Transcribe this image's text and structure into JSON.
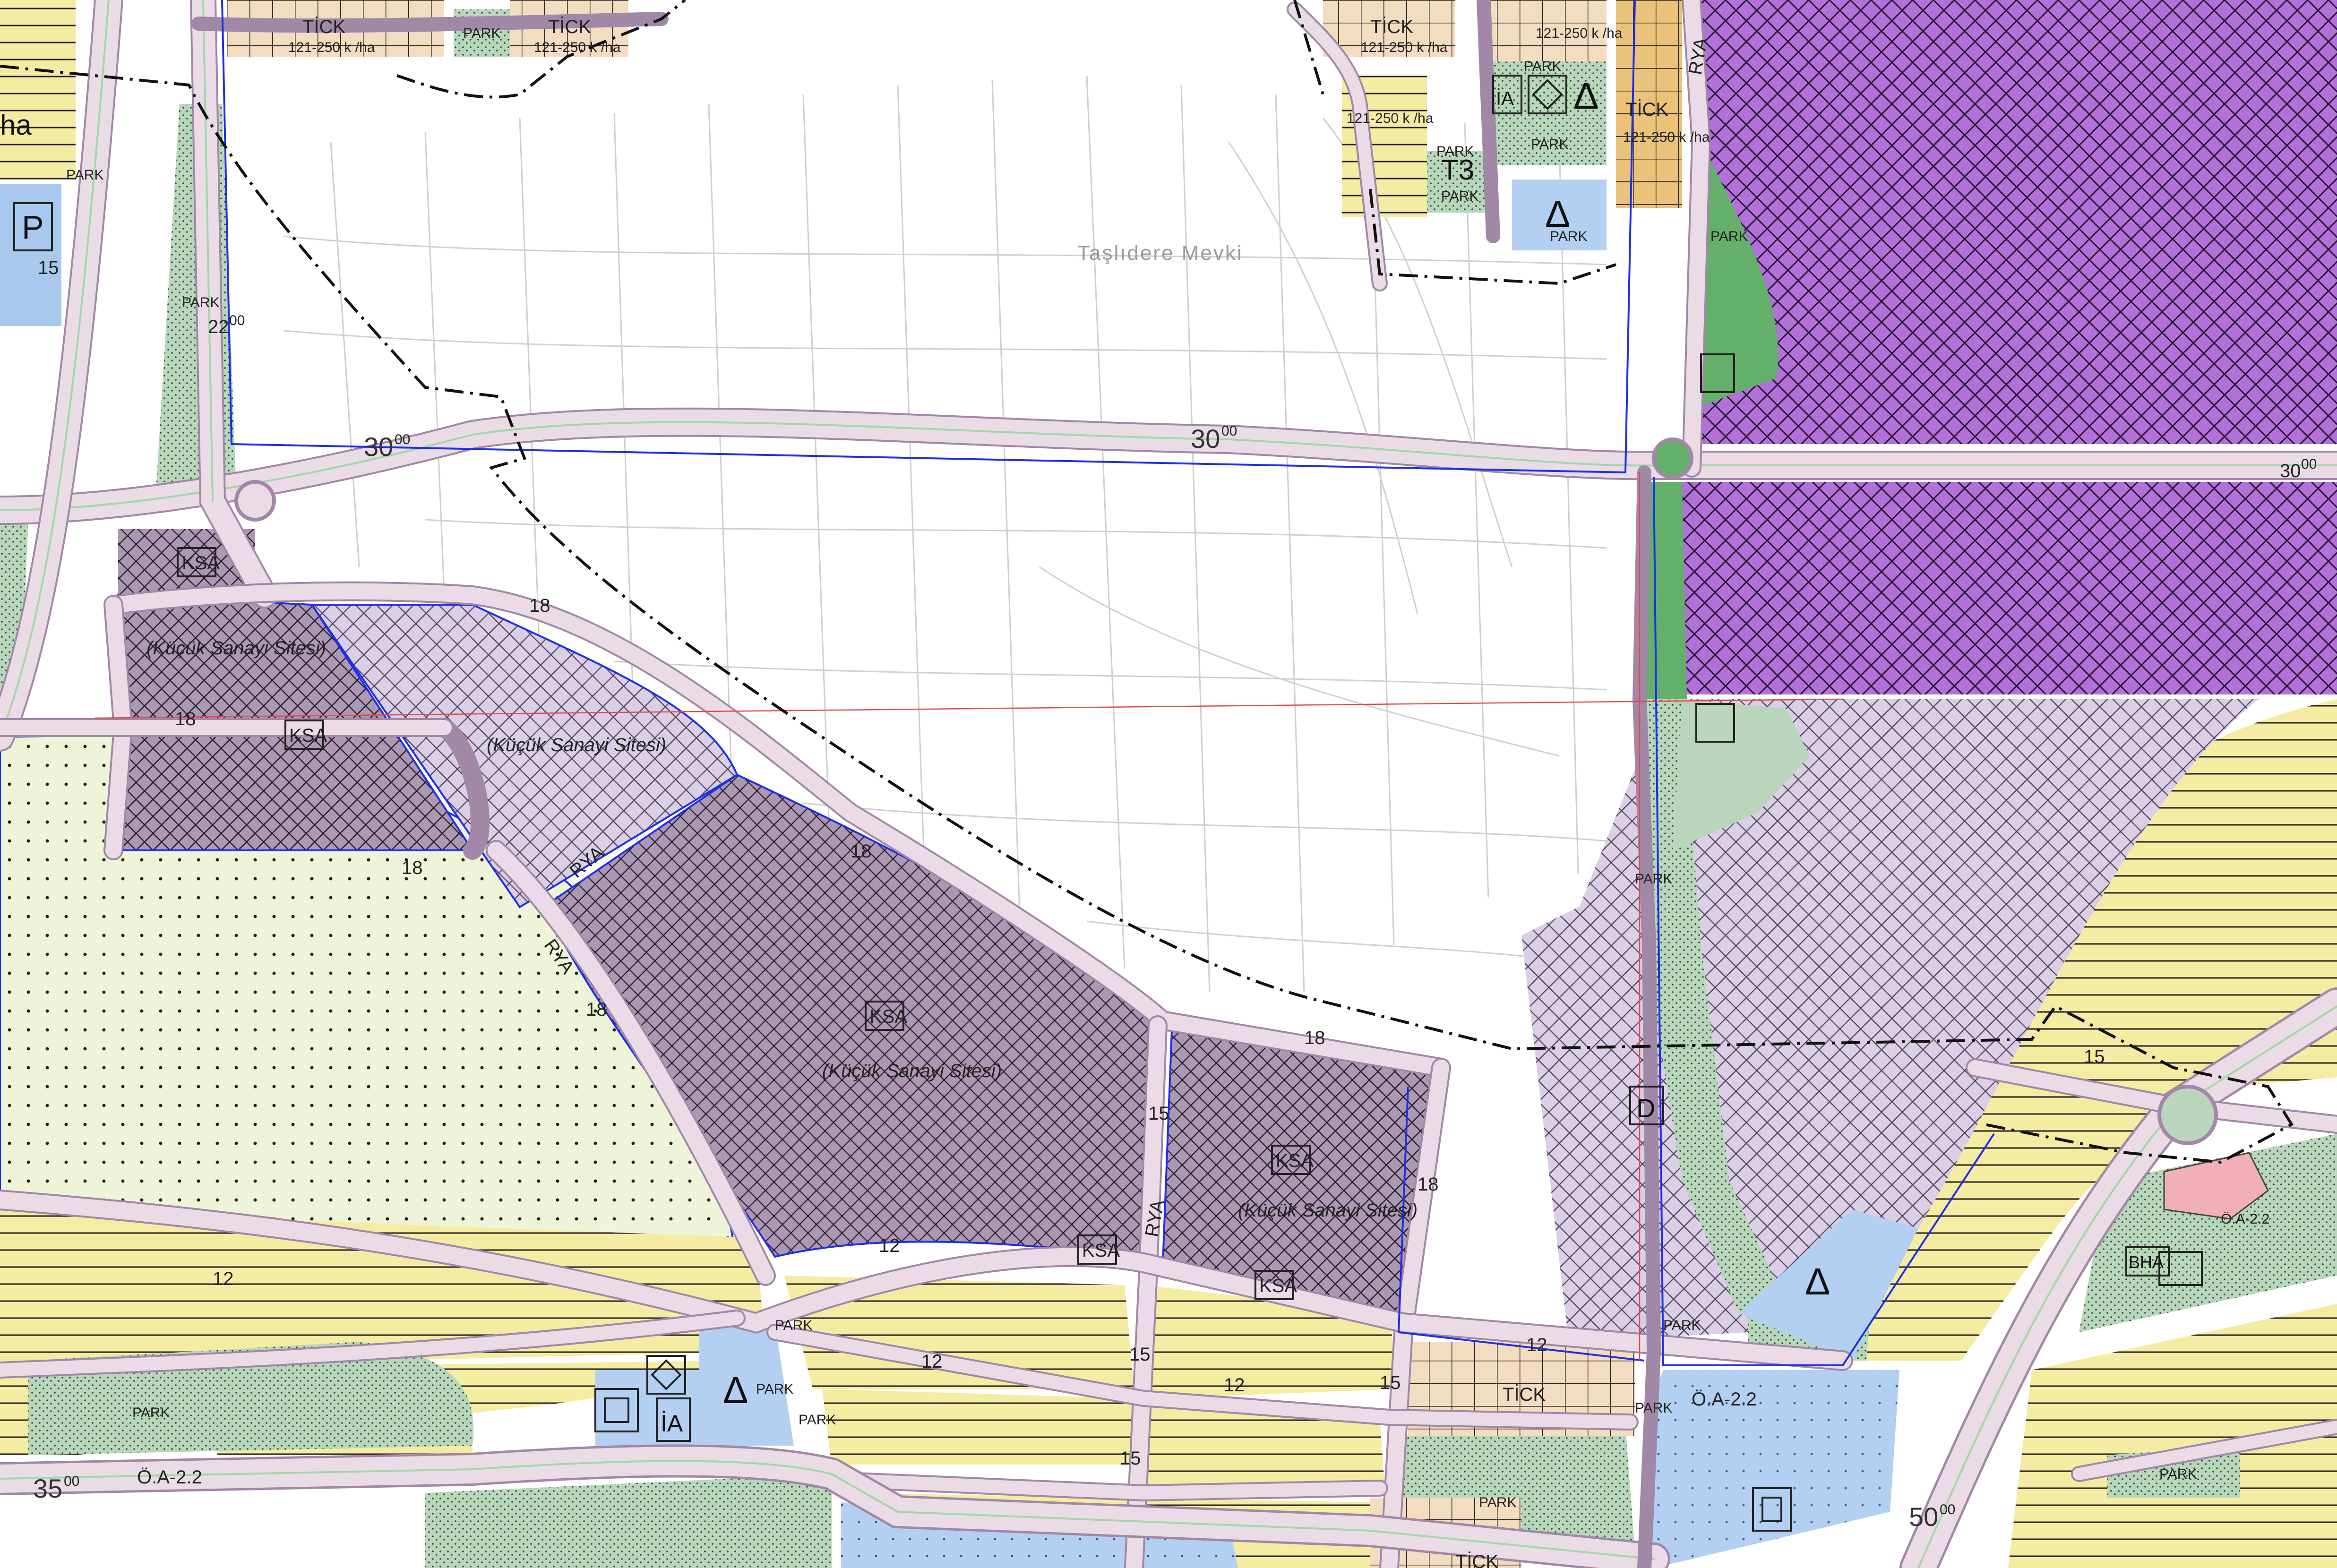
{
  "map": {
    "colors": {
      "residential": "#f5eca3",
      "commercial": "#f3dcbf",
      "commercial_dark": "#eac27a",
      "small_industry_dark": "#ad98b3",
      "small_industry_light": "#dbcfe6",
      "industry_purple": "#b171d8",
      "park": "#b9d6bc",
      "green_strip": "#64b06a",
      "orchard": "#eef4d8",
      "public": "#a8c8ed",
      "public_blue": "#b3cff2",
      "health": "#f1b0b6",
      "road_fill": "#eadbe7",
      "road_edge": "#a088a6",
      "road_green": "#9fd8a6",
      "boundary": "#111111",
      "blue_line": "#1e2fe8",
      "red_line": "#e04b4b"
    },
    "locality": "Taşlıdere Mevki",
    "labels": {
      "tick": "TİCK",
      "park": "PARK",
      "ksa": "KSA",
      "kucuk_sanayi": "(Küçük Sanayi Sitesi)",
      "rya": "RYA",
      "oa": "Ö.A-2.2",
      "density": "121-250 k /ha",
      "ha": "ha",
      "p": "P",
      "ia": "İA",
      "d": "D",
      "bha": "BHA",
      "t3": "T3",
      "triangle": "Δ"
    },
    "road_widths": {
      "w30a": "30",
      "w30b": "30",
      "w30c": "30",
      "w35": "35",
      "w50": "50",
      "w22": "22",
      "w18a": "18",
      "w18b": "18",
      "w18c": "18",
      "w18d": "18",
      "w18e": "18",
      "w18f": "18",
      "w18g": "18",
      "w15a": "15",
      "w15b": "15",
      "w15c": "15",
      "w15d": "15",
      "w15e": "15",
      "w15f": "15",
      "w12a": "12",
      "w12b": "12",
      "w12c": "12",
      "w12d": "12",
      "w12e": "12"
    },
    "superscript": "00"
  }
}
